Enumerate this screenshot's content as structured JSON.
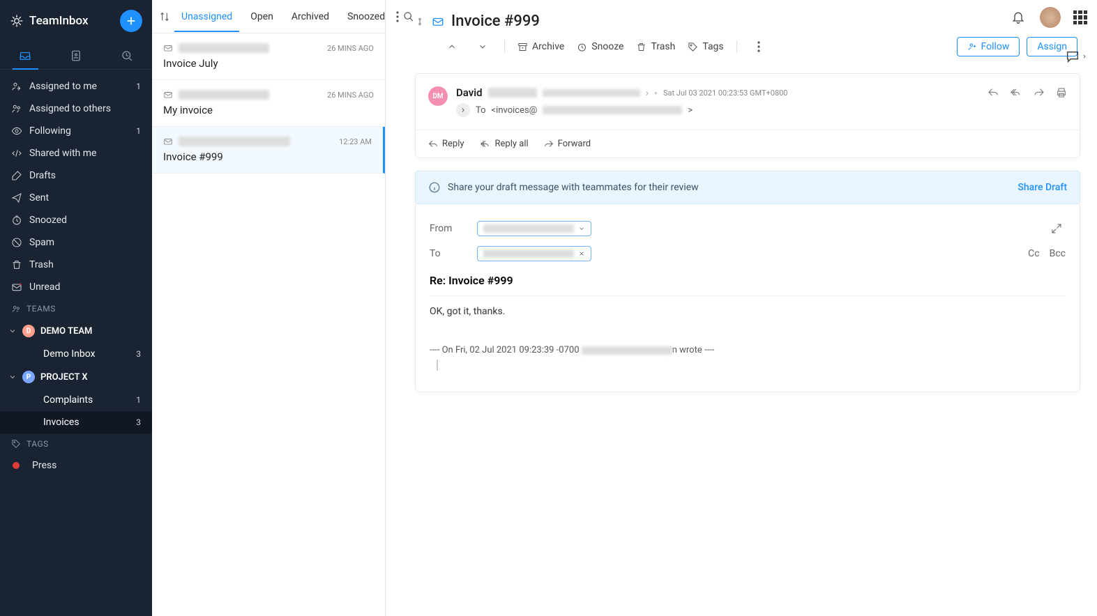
{
  "brand": "TeamInbox",
  "sidebar": {
    "nav": [
      {
        "label": "Assigned to me",
        "count": "1"
      },
      {
        "label": "Assigned to others"
      },
      {
        "label": "Following",
        "count": "1"
      },
      {
        "label": "Shared with me"
      },
      {
        "label": "Drafts"
      },
      {
        "label": "Sent"
      },
      {
        "label": "Snoozed"
      },
      {
        "label": "Spam"
      },
      {
        "label": "Trash"
      },
      {
        "label": "Unread"
      }
    ],
    "teams_label": "TEAMS",
    "teams": [
      {
        "initial": "D",
        "name": "DEMO TEAM",
        "children": [
          {
            "label": "Demo Inbox",
            "count": "3"
          }
        ]
      },
      {
        "initial": "P",
        "name": "PROJECT X",
        "children": [
          {
            "label": "Complaints",
            "count": "1"
          },
          {
            "label": "Invoices",
            "count": "3",
            "active": true
          }
        ]
      }
    ],
    "tags_label": "TAGS",
    "tags": [
      {
        "label": "Press"
      }
    ]
  },
  "list": {
    "tabs": [
      "Unassigned",
      "Open",
      "Archived",
      "Snoozed"
    ],
    "threads": [
      {
        "time": "26 MINS AGO",
        "subject": "Invoice July"
      },
      {
        "time": "26 MINS AGO",
        "subject": "My invoice"
      },
      {
        "time": "12:23 AM",
        "subject": "Invoice #999",
        "selected": true
      }
    ]
  },
  "main": {
    "subject": "Invoice #999",
    "actions": {
      "archive": "Archive",
      "snooze": "Snooze",
      "trash": "Trash",
      "tags": "Tags",
      "follow": "Follow",
      "assign": "Assign"
    },
    "message": {
      "badge": "DM",
      "sender_name": "David",
      "timestamp": "Sat Jul 03 2021 00:23:53 GMT+0800",
      "to_label": "To",
      "to_value": "<invoices@",
      "to_close": ">",
      "reply": "Reply",
      "replyall": "Reply all",
      "forward": "Forward"
    },
    "share": {
      "text": "Share your draft message with teammates for their review",
      "link": "Share Draft"
    },
    "compose": {
      "from_label": "From",
      "to_label": "To",
      "cc": "Cc",
      "bcc": "Bcc",
      "subject": "Re: Invoice #999",
      "body": "OK, got it, thanks.",
      "quote_head": "---- On Fri, 02 Jul 2021 09:23:39 -0700",
      "quote_tail": "n wrote ----"
    }
  }
}
